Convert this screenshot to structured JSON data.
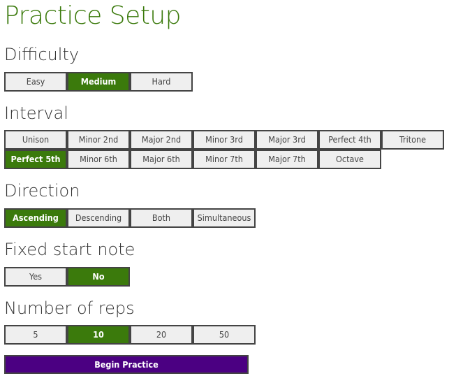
{
  "title": "Practice Setup",
  "accent_color": "#3b7a0c",
  "primary_button_color": "#4b0082",
  "sections": {
    "difficulty": {
      "heading": "Difficulty",
      "options": [
        "Easy",
        "Medium",
        "Hard"
      ],
      "selected": "Medium"
    },
    "interval": {
      "heading": "Interval",
      "options": [
        "Unison",
        "Minor 2nd",
        "Major 2nd",
        "Minor 3rd",
        "Major 3rd",
        "Perfect 4th",
        "Tritone",
        "Perfect 5th",
        "Minor 6th",
        "Major 6th",
        "Minor 7th",
        "Major 7th",
        "Octave"
      ],
      "selected": "Perfect 5th"
    },
    "direction": {
      "heading": "Direction",
      "options": [
        "Ascending",
        "Descending",
        "Both",
        "Simultaneous"
      ],
      "selected": "Ascending"
    },
    "fixed_start": {
      "heading": "Fixed start note",
      "options": [
        "Yes",
        "No"
      ],
      "selected": "No"
    },
    "reps": {
      "heading": "Number of reps",
      "options": [
        "5",
        "10",
        "20",
        "50"
      ],
      "selected": "10"
    }
  },
  "begin_button": "Begin Practice"
}
